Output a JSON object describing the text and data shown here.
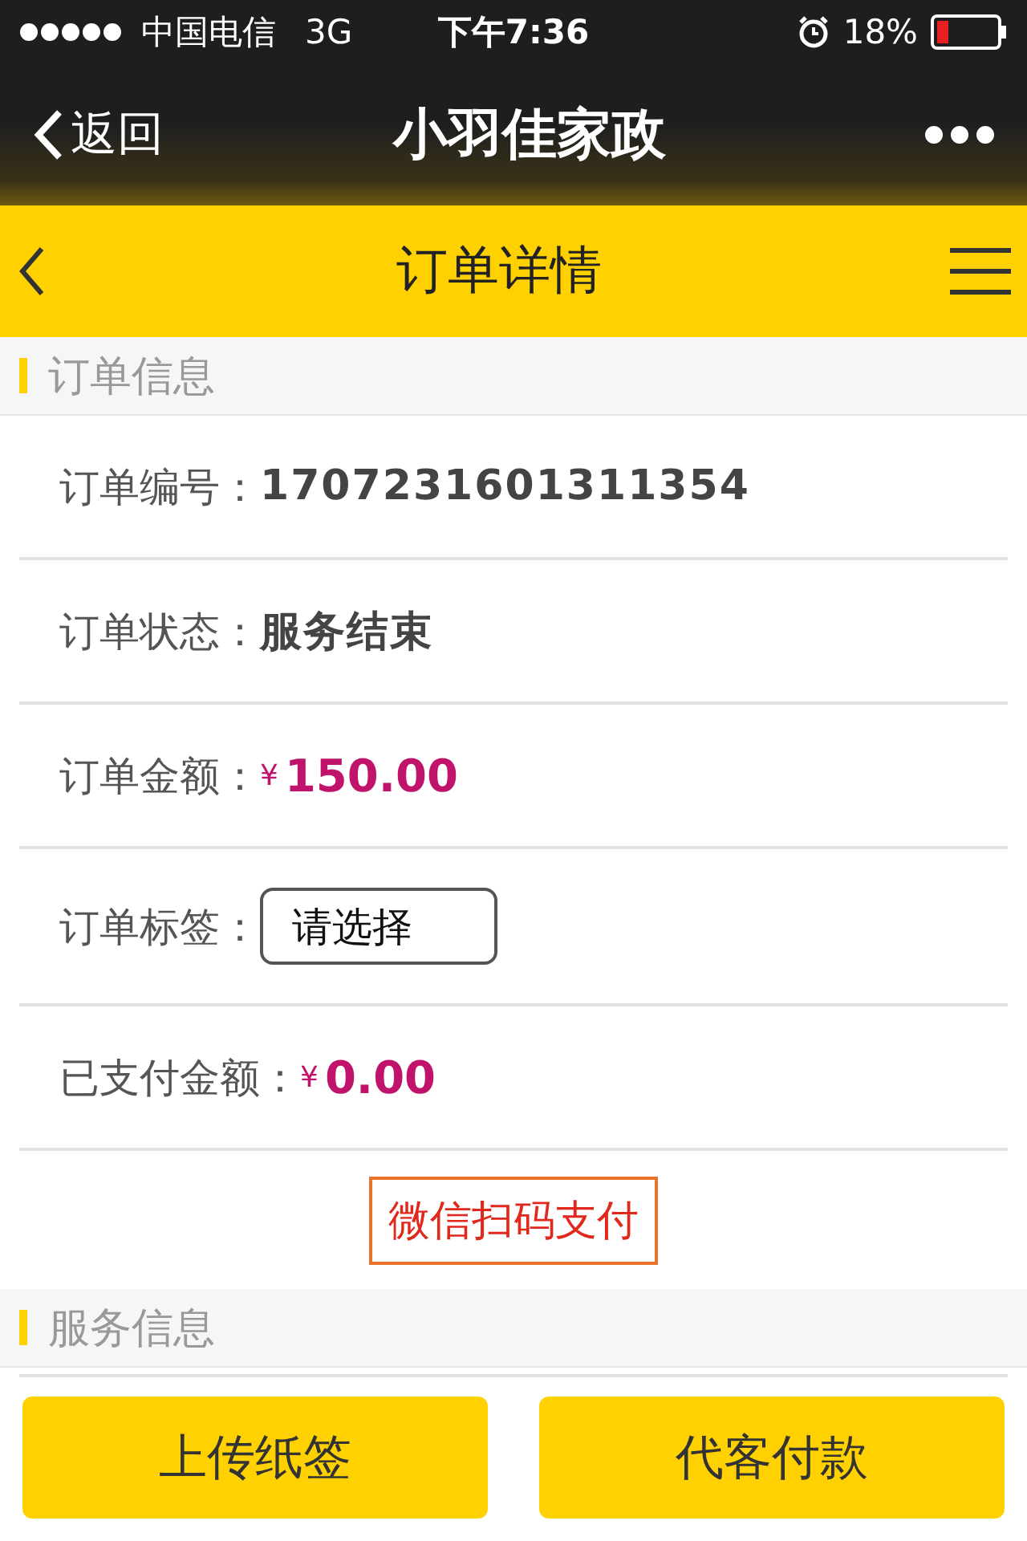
{
  "status_bar": {
    "carrier": "中国电信",
    "network": "3G",
    "time": "下午7:36",
    "battery": "18%"
  },
  "nav_bar": {
    "back": "返回",
    "title": "小羽佳家政"
  },
  "header": {
    "title": "订单详情"
  },
  "sections": [
    {
      "title": "订单信息",
      "rows": [
        {
          "kind": "text",
          "label": "订单编号：",
          "value": "1707231601311354"
        },
        {
          "kind": "text",
          "label": "订单状态：",
          "value": "服务结束"
        },
        {
          "kind": "price",
          "label": "订单金额：",
          "currency": "¥",
          "value": "150.00"
        },
        {
          "kind": "select",
          "label": "订单标签：",
          "placeholder": "请选择"
        },
        {
          "kind": "price",
          "label": "已支付金额：",
          "currency": "¥",
          "value": "0.00"
        }
      ],
      "action": "微信扫码支付"
    },
    {
      "title": "服务信息"
    }
  ],
  "buttons": [
    "上传纸签",
    "代客付款"
  ]
}
